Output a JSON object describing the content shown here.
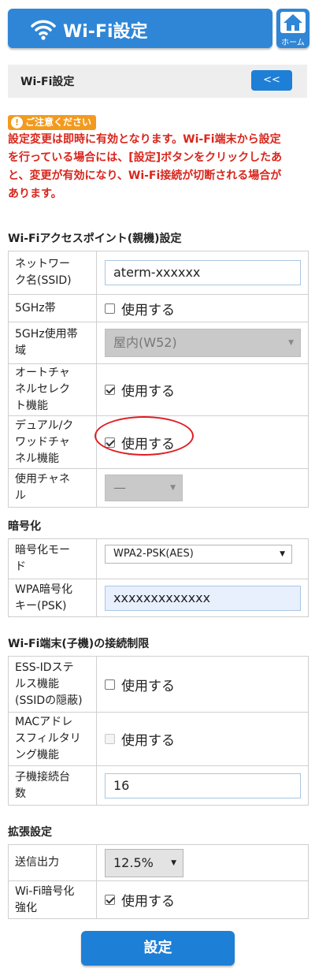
{
  "header": {
    "title": "Wi-Fi設定",
    "home_label": "ホーム"
  },
  "subbar": {
    "title": "Wi-Fi設定",
    "back_label": "<<"
  },
  "caution": {
    "badge": "ご注意ください",
    "lines": [
      "設定変更は即時に有効となります。Wi-Fi端末から設定",
      "を行っている場合には、[設定]ボタンをクリックしたあ",
      "と、変更が有効になり、Wi-Fi接続が切断される場合が",
      "あります。"
    ]
  },
  "sections": {
    "ap": {
      "title": "Wi-Fiアクセスポイント(親機)設定",
      "ssid": {
        "label": [
          "ネットワー",
          "ク名(SSID)"
        ],
        "value": "aterm-xxxxxx"
      },
      "band5": {
        "label": [
          "5GHz帯"
        ],
        "text": "使用する",
        "checked": false
      },
      "band5use": {
        "label": [
          "5GHz使用帯",
          "域"
        ],
        "value": "屋内(W52)"
      },
      "autoch": {
        "label": [
          "オートチャ",
          "ネルセレク",
          "ト機能"
        ],
        "text": "使用する",
        "checked": true
      },
      "dualch": {
        "label": [
          "デュアル/ク",
          "ワッドチャ",
          "ネル機能"
        ],
        "text": "使用する",
        "checked": true
      },
      "channel": {
        "label": [
          "使用チャネ",
          "ル"
        ],
        "value": "—"
      }
    },
    "enc": {
      "title": "暗号化",
      "mode": {
        "label": [
          "暗号化モー",
          "ド"
        ],
        "value": "WPA2-PSK(AES)"
      },
      "key": {
        "label": [
          "WPA暗号化",
          "キー(PSK)"
        ],
        "value": "xxxxxxxxxxxxx"
      }
    },
    "limit": {
      "title": "Wi-Fi端末(子機)の接続制限",
      "essid": {
        "label": [
          "ESS-IDステ",
          "ルス機能",
          "(SSIDの隠蔽)"
        ],
        "text": "使用する",
        "checked": false
      },
      "mac": {
        "label": [
          "MACアドレ",
          "スフィルタリ",
          "ング機能"
        ],
        "text": "使用する",
        "checked": false
      },
      "count": {
        "label": [
          "子機接続台",
          "数"
        ],
        "value": "16"
      }
    },
    "ext": {
      "title": "拡張設定",
      "power": {
        "label": [
          "送信出力"
        ],
        "value": "12.5%"
      },
      "encstrong": {
        "label": [
          "Wi-Fi暗号化",
          "強化"
        ],
        "text": "使用する",
        "checked": true
      }
    }
  },
  "submit_label": "設定",
  "colors": {
    "accent": "#2f86d6",
    "warning": "#d8261c",
    "badge": "#f39a1e",
    "highlight": "#e01d24"
  }
}
